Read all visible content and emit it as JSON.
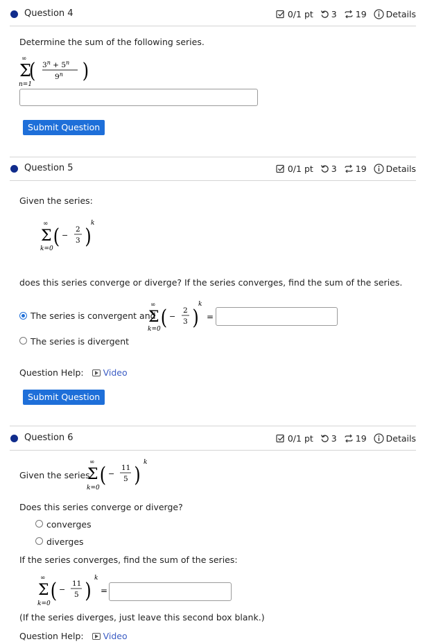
{
  "meta": {
    "score": "0/1 pt",
    "retries": "3",
    "attempts": "19",
    "details": "Details"
  },
  "q4": {
    "title": "Question 4",
    "prompt": "Determine the sum of the following series.",
    "submit": "Submit Question",
    "answer_value": ""
  },
  "q5": {
    "title": "Question 5",
    "given": "Given the series:",
    "question": "does this series converge or diverge? If the series converges, find the sum of the series.",
    "option_convergent": "The series is convergent and",
    "option_divergent": "The series is divergent",
    "selected": "convergent",
    "help_label": "Question Help:",
    "help_link": "Video",
    "submit": "Submit Question",
    "answer_value": ""
  },
  "q6": {
    "title": "Question 6",
    "given": "Given the series",
    "question": "Does this series converge or diverge?",
    "option_converges": "converges",
    "option_diverges": "diverges",
    "sum_prompt": "If the series converges, find the sum of the series:",
    "note": "(If the series diverges, just leave this second box blank.)",
    "help_label": "Question Help:",
    "help_link": "Video",
    "answer_value": ""
  },
  "colors": {
    "accent": "#1e6fd9",
    "bullet": "#102c8c",
    "link": "#3b5cc4"
  },
  "icons": [
    "check-square-icon",
    "retry-icon",
    "attempts-icon",
    "info-icon",
    "video-icon"
  ]
}
